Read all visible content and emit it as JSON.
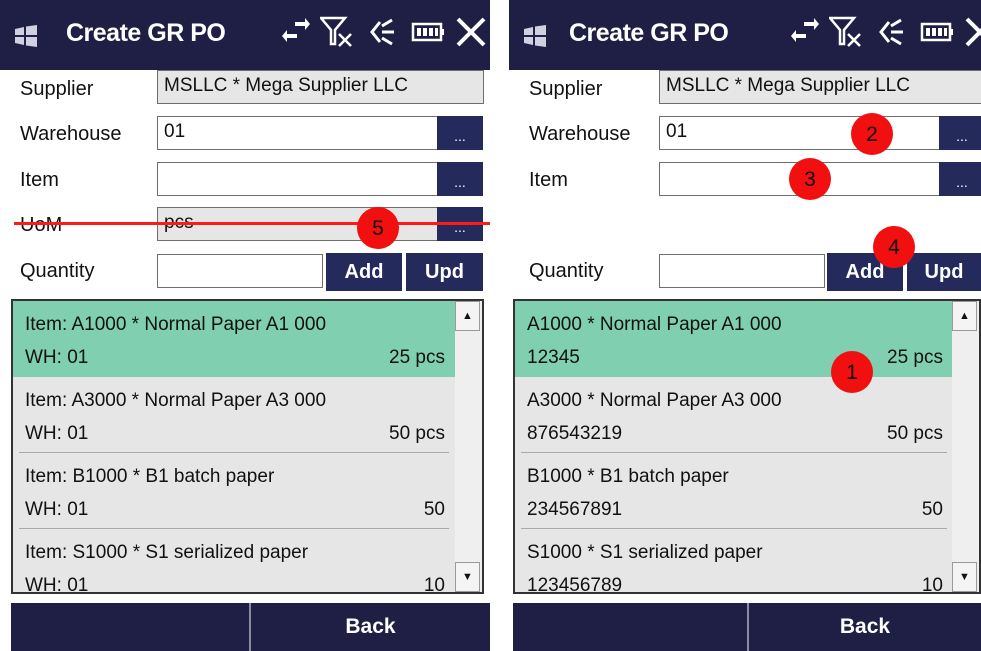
{
  "left": {
    "title": "Create GR PO",
    "labels": {
      "supplier": "Supplier",
      "warehouse": "Warehouse",
      "item": "Item",
      "uom": "UoM",
      "quantity": "Quantity"
    },
    "fields": {
      "supplier": "MSLLC * Mega Supplier LLC",
      "warehouse": "01",
      "item": "",
      "uom": "pcs",
      "quantity": ""
    },
    "lookup_button": "...",
    "add_label": "Add",
    "upd_label": "Upd",
    "items": [
      {
        "line1": "Item: A1000 * Normal Paper A1 000",
        "line2": "WH: 01",
        "qty": "25 pcs",
        "selected": true
      },
      {
        "line1": "Item: A3000 * Normal Paper A3 000",
        "line2": "WH: 01",
        "qty": "50 pcs",
        "selected": false
      },
      {
        "line1": "Item: B1000 * B1 batch paper",
        "line2": "WH: 01",
        "qty": "50",
        "selected": false
      },
      {
        "line1": "Item: S1000 * S1 serialized paper",
        "line2": "WH: 01",
        "qty": "10",
        "selected": false
      }
    ],
    "back_label": "Back",
    "markers": [
      "5"
    ]
  },
  "right": {
    "title": "Create GR PO",
    "labels": {
      "supplier": "Supplier",
      "warehouse": "Warehouse",
      "item": "Item",
      "quantity": "Quantity"
    },
    "fields": {
      "supplier": "MSLLC * Mega Supplier LLC",
      "warehouse": "01",
      "item": "",
      "quantity": ""
    },
    "lookup_button": "...",
    "add_label": "Add",
    "upd_label": "Upd",
    "items": [
      {
        "line1": "A1000 * Normal Paper A1 000",
        "line2": "12345",
        "qty": "25 pcs",
        "selected": true
      },
      {
        "line1": "A3000 * Normal Paper A3 000",
        "line2": "876543219",
        "qty": "50 pcs",
        "selected": false
      },
      {
        "line1": "B1000 * B1 batch paper",
        "line2": "234567891",
        "qty": "50",
        "selected": false
      },
      {
        "line1": "S1000 * S1 serialized paper",
        "line2": "123456789",
        "qty": "10",
        "selected": false
      }
    ],
    "back_label": "Back",
    "markers": [
      "1",
      "2",
      "3",
      "4"
    ]
  },
  "colors": {
    "titlebar": "#1f1f45",
    "button": "#252a5d",
    "selected_row": "#7fcfb0",
    "marker": "#f20f0f"
  },
  "icons": [
    "windows-logo-icon",
    "sync-icon",
    "no-signal-icon",
    "speaker-icon",
    "battery-icon",
    "close-icon",
    "scroll-up-icon",
    "scroll-down-icon"
  ]
}
